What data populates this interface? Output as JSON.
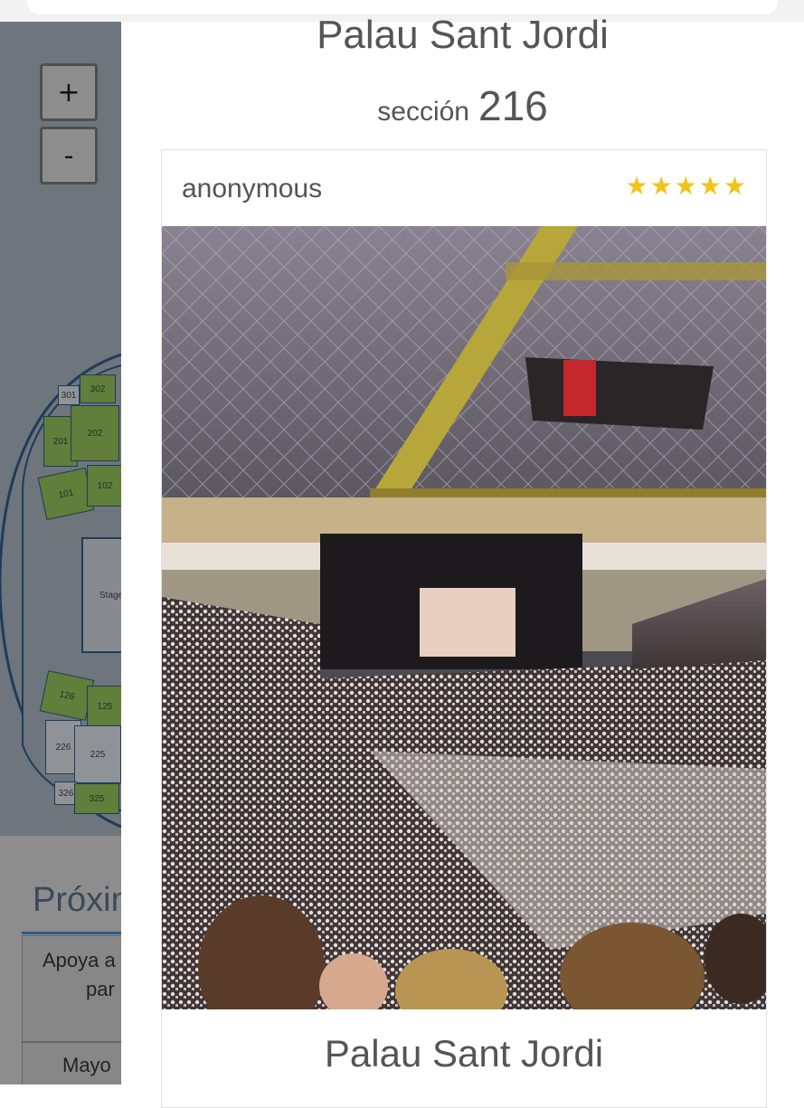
{
  "map": {
    "zoom_in_label": "+",
    "zoom_out_label": "-",
    "stage_label": "Stage",
    "sections": [
      "301",
      "302",
      "201",
      "202",
      "101",
      "102",
      "126",
      "125",
      "226",
      "225",
      "326",
      "325"
    ]
  },
  "upcoming": {
    "title": "Próxin",
    "row1_line1": "Apoya a",
    "row1_line2": "par",
    "row2": "Mayo"
  },
  "modal": {
    "venue_title": "Palau Sant Jordi",
    "section_label": "sección",
    "section_number": "216"
  },
  "review": {
    "author": "anonymous",
    "rating": 5,
    "stars": [
      "★",
      "★",
      "★",
      "★",
      "★"
    ],
    "caption": "Palau Sant Jordi"
  },
  "colors": {
    "star": "#f2c31b",
    "section_green": "#5f7f3a",
    "overlay_gray": "#8d8d8d"
  }
}
